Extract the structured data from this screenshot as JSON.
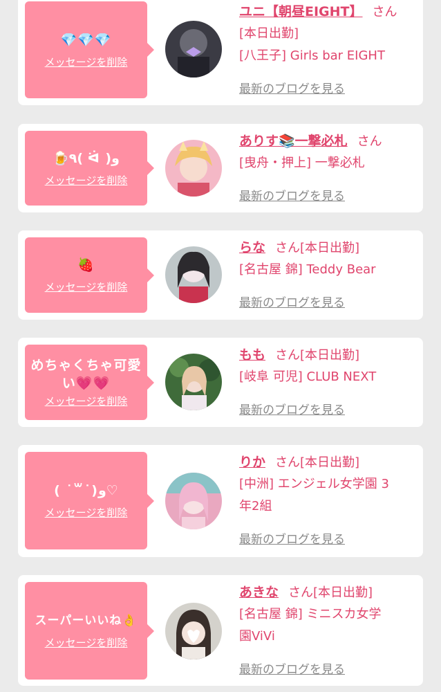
{
  "san_label": "さん",
  "delete_label": "メッセージを削除",
  "blog_label": "最新のブログを見る",
  "cards": [
    {
      "message": "💎💎💎",
      "name": "ユニ【朝昼EIGHT】",
      "status": "",
      "line1": "[本日出勤]",
      "line2": "[八王子] Girls bar EIGHT",
      "line3": ""
    },
    {
      "message": "🍺٩( ᐛ )و",
      "name": "ありす📚一撃必札",
      "status": "",
      "line1": "[曳舟・押上] 一撃必札",
      "line2": "",
      "line3": ""
    },
    {
      "message": "🍓",
      "name": "らな",
      "status": "[本日出勤]",
      "line1": "[名古屋 錦] Teddy Bear",
      "line2": "",
      "line3": ""
    },
    {
      "message": "めちゃくちゃ可愛い💗💗",
      "name": "もも",
      "status": "[本日出勤]",
      "line1": "[岐阜 可児] CLUB NEXT",
      "line2": "",
      "line3": ""
    },
    {
      "message": "( ˙꒳˙)و♡",
      "name": "りか",
      "status": "[本日出勤]",
      "line1": "[中洲] エンジェル女学園 3",
      "line2": "年2組",
      "line3": ""
    },
    {
      "message": "スーパーいいね👌",
      "name": "あきな",
      "status": "[本日出勤]",
      "line1": "[名古屋 錦] ミニスカ女学",
      "line2": "園ViVi",
      "line3": ""
    }
  ]
}
